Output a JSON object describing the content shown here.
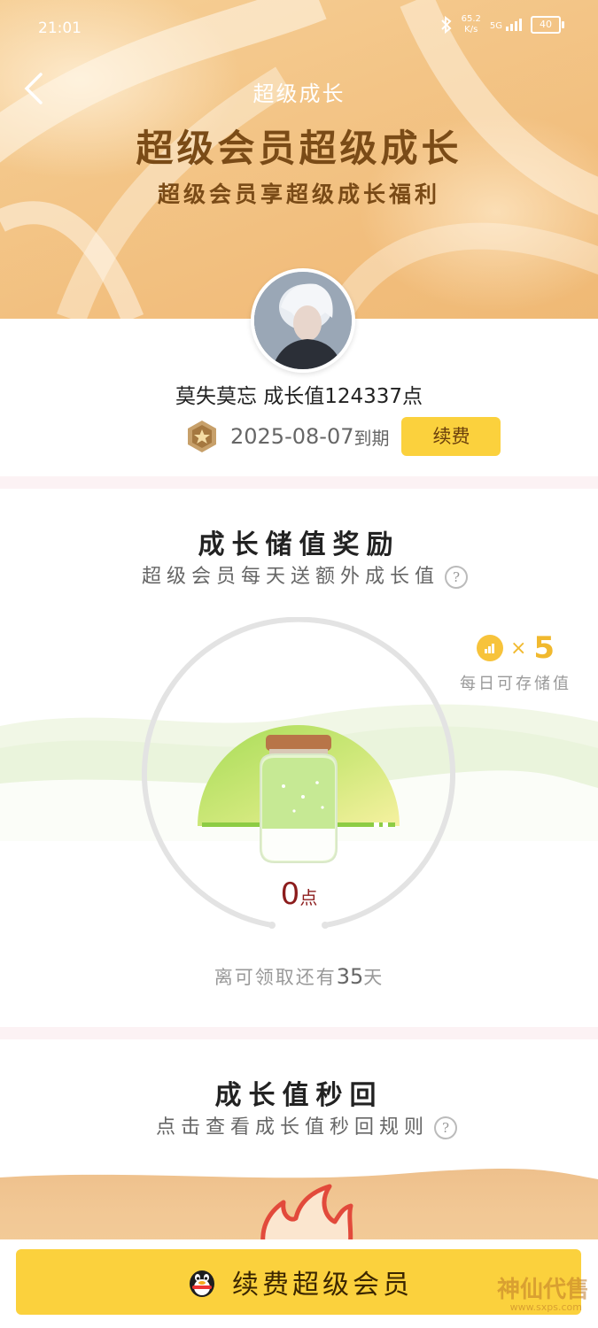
{
  "status_bar": {
    "time": "21:01",
    "net_speed": "65.2",
    "net_unit": "K/s",
    "signal": "5G",
    "battery": "40"
  },
  "header": {
    "nav_title": "超级成长",
    "hero_title": "超级会员超级成长",
    "hero_subtitle": "超级会员享超级成长福利"
  },
  "profile": {
    "line": "莫失莫忘 成长值124337点",
    "expire_date": "2025-08-07",
    "expire_suffix": "到期",
    "renew_label": "续费"
  },
  "storage": {
    "title": "成长储值奖励",
    "subtitle": "超级会员每天送额外成长值",
    "help": "?",
    "daily_multiplier": "×",
    "daily_count": "5",
    "daily_label": "每日可存储值",
    "points": "0",
    "points_unit": "点",
    "countdown_prefix": "离可领取还有",
    "countdown_days": "35",
    "countdown_suffix": "天"
  },
  "instant": {
    "title": "成长值秒回",
    "subtitle": "点击查看成长值秒回规则",
    "help": "?"
  },
  "bottom": {
    "renew_label": "续费超级会员"
  },
  "watermark": {
    "text": "神仙代售",
    "url": "www.sxps.com"
  },
  "colors": {
    "accent": "#fbd13d",
    "brand_brown": "#7a4b17",
    "points_red": "#8c1c1c",
    "green": "#8dcc44"
  },
  "icons": [
    "back-icon",
    "bluetooth-icon",
    "signal-icon",
    "battery-icon",
    "vip-badge-icon",
    "help-icon",
    "coin-icon",
    "jar-icon",
    "fire-icon",
    "qq-penguin-icon"
  ]
}
